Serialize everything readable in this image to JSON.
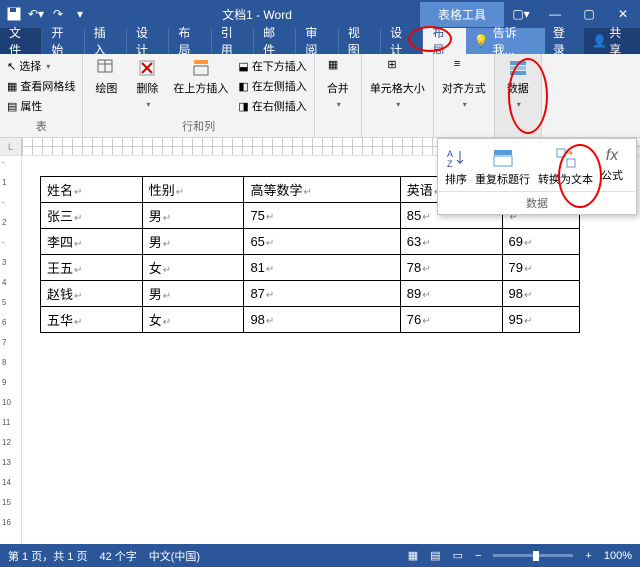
{
  "titlebar": {
    "doc_title": "文档1 - Word",
    "context_title": "表格工具"
  },
  "tabs": {
    "file": "文件",
    "home": "开始",
    "insert": "插入",
    "design": "设计",
    "layout": "布局",
    "references": "引用",
    "mail": "邮件",
    "review": "审阅",
    "view": "视图",
    "tbl_design": "设计",
    "tbl_layout": "布局",
    "tell_me": "告诉我...",
    "login": "登录",
    "share": "共享"
  },
  "ribbon": {
    "select": "选择",
    "view_gridlines": "查看网格线",
    "properties": "属性",
    "group_table": "表",
    "draw": "绘图",
    "delete": "删除",
    "insert_above": "在上方插入",
    "insert_below": "在下方插入",
    "insert_left": "在左侧插入",
    "insert_right": "在右侧插入",
    "group_rowcol": "行和列",
    "merge": "合并",
    "cell_size": "单元格大小",
    "align": "对齐方式",
    "data": "数据"
  },
  "dropdown": {
    "sort": "排序",
    "repeat_header": "重复标题行",
    "convert_text": "转换为文本",
    "formula": "公式",
    "group": "数据"
  },
  "table": {
    "headers": [
      "姓名",
      "性别",
      "高等数学",
      "英语",
      ""
    ],
    "rows": [
      [
        "张三",
        "男",
        "75",
        "85",
        ""
      ],
      [
        "李四",
        "男",
        "65",
        "63",
        "69"
      ],
      [
        "王五",
        "女",
        "81",
        "78",
        "79"
      ],
      [
        "赵钱",
        "男",
        "87",
        "89",
        "98"
      ],
      [
        "五华",
        "女",
        "98",
        "76",
        "95"
      ]
    ]
  },
  "ruler_corner": "L",
  "ruler_v_nums": [
    "-",
    "1",
    "-",
    "2",
    "-",
    "3",
    "4",
    "5",
    "6",
    "7",
    "8",
    "9",
    "10",
    "11",
    "12",
    "13",
    "14",
    "15",
    "16"
  ],
  "status": {
    "page": "第 1 页，共 1 页",
    "words": "42 个字",
    "lang": "中文(中国)",
    "zoom": "100%"
  }
}
